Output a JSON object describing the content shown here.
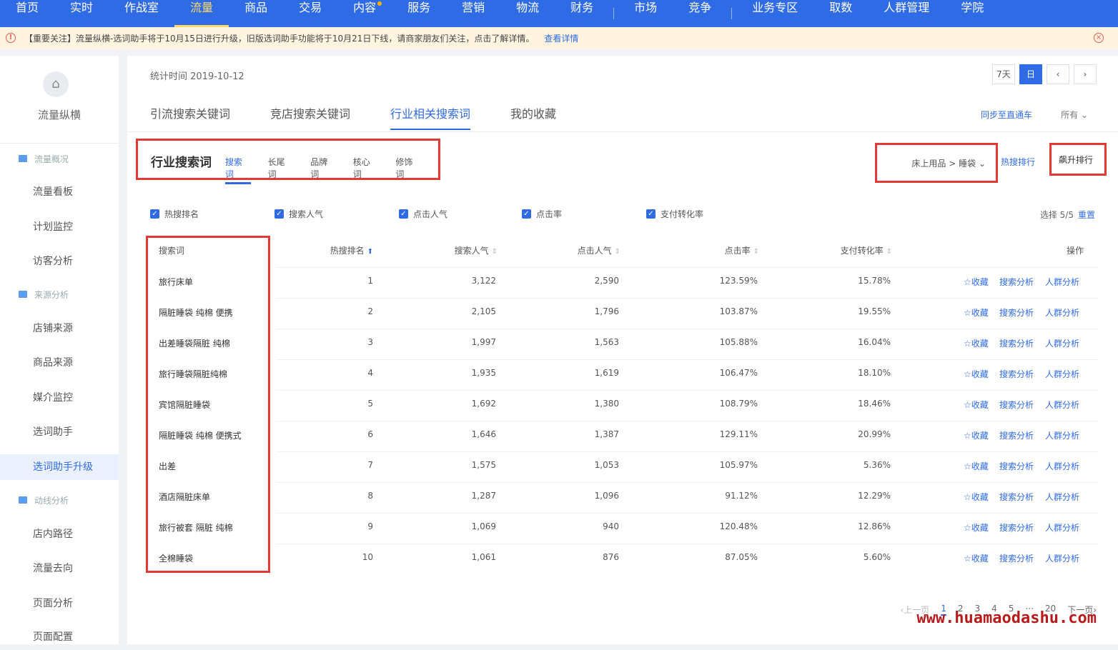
{
  "topnav": {
    "items": [
      {
        "label": "首页"
      },
      {
        "label": "实时"
      },
      {
        "label": "作战室"
      },
      {
        "label": "流量",
        "active": true
      },
      {
        "label": "商品"
      },
      {
        "label": "交易"
      },
      {
        "label": "内容",
        "dot": true
      },
      {
        "label": "服务"
      },
      {
        "label": "营销"
      },
      {
        "label": "物流"
      },
      {
        "label": "财务"
      },
      {
        "label": "市场"
      },
      {
        "label": "竞争"
      },
      {
        "label": "业务专区"
      },
      {
        "label": "取数"
      },
      {
        "label": "人群管理"
      },
      {
        "label": "学院"
      }
    ]
  },
  "notice": {
    "text": "【重要关注】流量纵横-选词助手将于10月15日进行升级，旧版选词助手功能将于10月21日下线，请商家朋友们关注，点击了解详情。",
    "link": "查看详情"
  },
  "sidebar": {
    "title": "流量纵横",
    "items": [
      {
        "label": "流量概况",
        "group": true
      },
      {
        "label": "流量看板"
      },
      {
        "label": "计划监控"
      },
      {
        "label": "访客分析"
      },
      {
        "label": "来源分析",
        "group": true
      },
      {
        "label": "店铺来源"
      },
      {
        "label": "商品来源"
      },
      {
        "label": "媒介监控"
      },
      {
        "label": "选词助手"
      },
      {
        "label": "选词助手升级",
        "active": true
      },
      {
        "label": "动线分析",
        "group": true
      },
      {
        "label": "店内路径"
      },
      {
        "label": "流量去向"
      },
      {
        "label": "页面分析"
      },
      {
        "label": "页面配置"
      }
    ]
  },
  "header": {
    "stat_time": "统计时间 2019-10-12",
    "date_buttons": [
      "7天",
      "日",
      "‹",
      "›"
    ]
  },
  "tabs": [
    "引流搜索关键词",
    "竞店搜索关键词",
    "行业相关搜索词",
    "我的收藏"
  ],
  "sync_link": "同步至直通车",
  "all_select": "所有",
  "section": {
    "title": "行业搜索词",
    "sub_tabs": [
      "搜索词",
      "长尾词",
      "品牌词",
      "核心词",
      "修饰词"
    ],
    "category": "床上用品 > 睡袋",
    "hot_rank": "热搜排行",
    "rise_rank": "飙升排行"
  },
  "checks": [
    "热搜排名",
    "搜索人气",
    "点击人气",
    "点击率",
    "支付转化率"
  ],
  "selection": {
    "count": "选择 5/5",
    "reset": "重置"
  },
  "table": {
    "headers": [
      "搜索词",
      "热搜排名",
      "搜索人气",
      "点击人气",
      "点击率",
      "支付转化率",
      "操作"
    ],
    "actions": [
      "☆收藏",
      "搜索分析",
      "人群分析"
    ],
    "rows": [
      {
        "kw": "旅行床单",
        "rank": "1",
        "search": "3,122",
        "click": "2,590",
        "ctr": "123.59%",
        "cvr": "15.78%"
      },
      {
        "kw": "隔脏睡袋 纯棉 便携",
        "rank": "2",
        "search": "2,105",
        "click": "1,796",
        "ctr": "103.87%",
        "cvr": "19.55%"
      },
      {
        "kw": "出差睡袋隔脏 纯棉",
        "rank": "3",
        "search": "1,997",
        "click": "1,563",
        "ctr": "105.88%",
        "cvr": "16.04%"
      },
      {
        "kw": "旅行睡袋隔脏纯棉",
        "rank": "4",
        "search": "1,935",
        "click": "1,619",
        "ctr": "106.47%",
        "cvr": "18.10%"
      },
      {
        "kw": "宾馆隔脏睡袋",
        "rank": "5",
        "search": "1,692",
        "click": "1,380",
        "ctr": "108.79%",
        "cvr": "18.46%"
      },
      {
        "kw": "隔脏睡袋 纯棉 便携式",
        "rank": "6",
        "search": "1,646",
        "click": "1,387",
        "ctr": "129.11%",
        "cvr": "20.99%"
      },
      {
        "kw": "出差",
        "rank": "7",
        "search": "1,575",
        "click": "1,053",
        "ctr": "105.97%",
        "cvr": "5.36%"
      },
      {
        "kw": "酒店隔脏床单",
        "rank": "8",
        "search": "1,287",
        "click": "1,096",
        "ctr": "91.12%",
        "cvr": "12.29%"
      },
      {
        "kw": "旅行被套 隔脏 纯棉",
        "rank": "9",
        "search": "1,069",
        "click": "940",
        "ctr": "120.48%",
        "cvr": "12.86%"
      },
      {
        "kw": "全棉睡袋",
        "rank": "10",
        "search": "1,061",
        "click": "876",
        "ctr": "87.05%",
        "cvr": "5.60%"
      }
    ]
  },
  "pager": [
    "‹上一页",
    "1",
    "2",
    "3",
    "4",
    "5",
    "···",
    "20",
    "下一页›"
  ],
  "watermark": "www.huamaodashu.com"
}
